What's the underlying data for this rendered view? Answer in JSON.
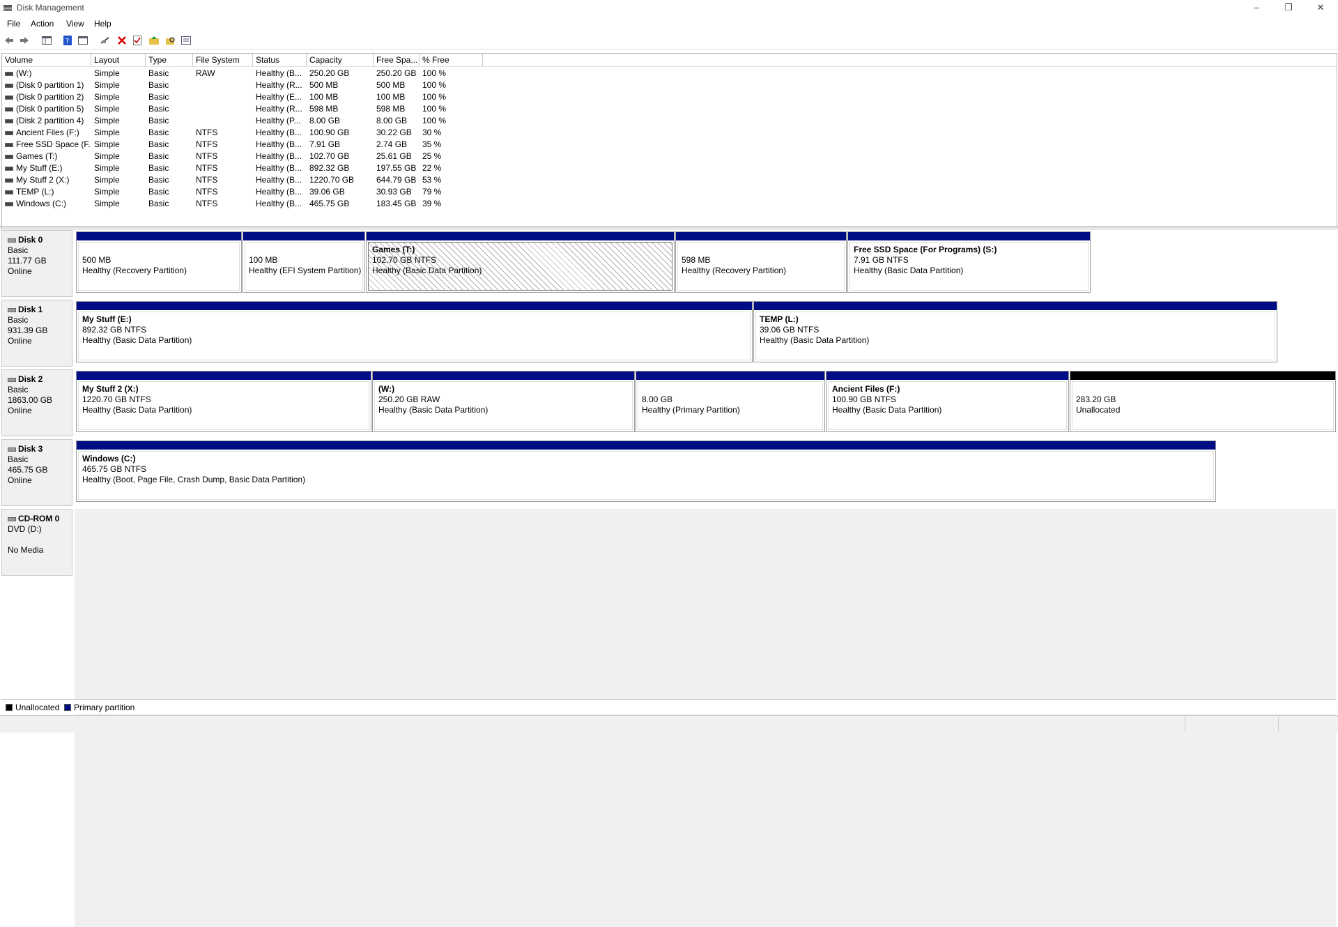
{
  "window": {
    "title": "Disk Management",
    "minimize": "–",
    "restore": "❐",
    "close": "✕"
  },
  "menus": [
    "File",
    "Action",
    "View",
    "Help"
  ],
  "toolbar": {
    "icons": [
      "back-arrow-icon",
      "forward-arrow-icon",
      "console-tree-icon",
      "help-icon",
      "properties-icon",
      "connect-icon",
      "delete-icon",
      "checkmark-icon",
      "folder-up-icon",
      "search-folder-icon",
      "view-icon"
    ]
  },
  "volume_list": {
    "columns": [
      "Volume",
      "Layout",
      "Type",
      "File System",
      "Status",
      "Capacity",
      "Free Spa...",
      "% Free"
    ],
    "rows": [
      [
        "(W:)",
        "Simple",
        "Basic",
        "RAW",
        "Healthy (B...",
        "250.20 GB",
        "250.20 GB",
        "100 %"
      ],
      [
        "(Disk 0 partition 1)",
        "Simple",
        "Basic",
        "",
        "Healthy (R...",
        "500 MB",
        "500 MB",
        "100 %"
      ],
      [
        "(Disk 0 partition 2)",
        "Simple",
        "Basic",
        "",
        "Healthy (E...",
        "100 MB",
        "100 MB",
        "100 %"
      ],
      [
        "(Disk 0 partition 5)",
        "Simple",
        "Basic",
        "",
        "Healthy (R...",
        "598 MB",
        "598 MB",
        "100 %"
      ],
      [
        "(Disk 2 partition 4)",
        "Simple",
        "Basic",
        "",
        "Healthy (P...",
        "8.00 GB",
        "8.00 GB",
        "100 %"
      ],
      [
        "Ancient Files (F:)",
        "Simple",
        "Basic",
        "NTFS",
        "Healthy (B...",
        "100.90 GB",
        "30.22 GB",
        "30 %"
      ],
      [
        "Free SSD Space (F...",
        "Simple",
        "Basic",
        "NTFS",
        "Healthy (B...",
        "7.91 GB",
        "2.74 GB",
        "35 %"
      ],
      [
        "Games (T:)",
        "Simple",
        "Basic",
        "NTFS",
        "Healthy (B...",
        "102.70 GB",
        "25.61 GB",
        "25 %"
      ],
      [
        "My Stuff (E:)",
        "Simple",
        "Basic",
        "NTFS",
        "Healthy (B...",
        "892.32 GB",
        "197.55 GB",
        "22 %"
      ],
      [
        "My Stuff 2 (X:)",
        "Simple",
        "Basic",
        "NTFS",
        "Healthy (B...",
        "1220.70 GB",
        "644.79 GB",
        "53 %"
      ],
      [
        "TEMP (L:)",
        "Simple",
        "Basic",
        "NTFS",
        "Healthy (B...",
        "39.06 GB",
        "30.93 GB",
        "79 %"
      ],
      [
        "Windows (C:)",
        "Simple",
        "Basic",
        "NTFS",
        "Healthy (B...",
        "465.75 GB",
        "183.45 GB",
        "39 %"
      ]
    ]
  },
  "disks": [
    {
      "name": "Disk 0",
      "type": "Basic",
      "size": "111.77 GB",
      "status": "Online",
      "partitions": [
        {
          "name": "",
          "size": "500 MB",
          "status": "Healthy (Recovery Partition)",
          "unalloc": false,
          "selected": false
        },
        {
          "name": "",
          "size": "100 MB",
          "status": "Healthy (EFI System Partition)",
          "unalloc": false,
          "selected": false
        },
        {
          "name": "Games  (T:)",
          "size": "102.70 GB NTFS",
          "status": "Healthy (Basic Data Partition)",
          "unalloc": false,
          "selected": true
        },
        {
          "name": "",
          "size": "598 MB",
          "status": "Healthy (Recovery Partition)",
          "unalloc": false,
          "selected": false
        },
        {
          "name": "Free SSD Space (For Programs)  (S:)",
          "size": "7.91 GB NTFS",
          "status": "Healthy (Basic Data Partition)",
          "unalloc": false,
          "selected": false
        }
      ]
    },
    {
      "name": "Disk 1",
      "type": "Basic",
      "size": "931.39 GB",
      "status": "Online",
      "partitions": [
        {
          "name": "My Stuff  (E:)",
          "size": "892.32 GB NTFS",
          "status": "Healthy (Basic Data Partition)",
          "unalloc": false,
          "selected": false
        },
        {
          "name": "TEMP  (L:)",
          "size": "39.06 GB NTFS",
          "status": "Healthy (Basic Data Partition)",
          "unalloc": false,
          "selected": false
        }
      ]
    },
    {
      "name": "Disk 2",
      "type": "Basic",
      "size": "1863.00 GB",
      "status": "Online",
      "partitions": [
        {
          "name": "My Stuff 2  (X:)",
          "size": "1220.70 GB NTFS",
          "status": "Healthy (Basic Data Partition)",
          "unalloc": false,
          "selected": false
        },
        {
          "name": "(W:)",
          "size": "250.20 GB RAW",
          "status": "Healthy (Basic Data Partition)",
          "unalloc": false,
          "selected": false
        },
        {
          "name": "",
          "size": "8.00 GB",
          "status": "Healthy (Primary Partition)",
          "unalloc": false,
          "selected": false
        },
        {
          "name": "Ancient Files  (F:)",
          "size": "100.90 GB NTFS",
          "status": "Healthy (Basic Data Partition)",
          "unalloc": false,
          "selected": false
        },
        {
          "name": "",
          "size": "283.20 GB",
          "status": "Unallocated",
          "unalloc": true,
          "selected": false
        }
      ]
    },
    {
      "name": "Disk 3",
      "type": "Basic",
      "size": "465.75 GB",
      "status": "Online",
      "partitions": [
        {
          "name": "Windows  (C:)",
          "size": "465.75 GB NTFS",
          "status": "Healthy (Boot, Page File, Crash Dump, Basic Data Partition)",
          "unalloc": false,
          "selected": false
        }
      ]
    }
  ],
  "cdrom": {
    "name": "CD-ROM 0",
    "drive": "DVD (D:)",
    "media": "No Media"
  },
  "legend": [
    {
      "label": "Unallocated",
      "color": "#000000"
    },
    {
      "label": "Primary partition",
      "color": "#000e85"
    }
  ]
}
